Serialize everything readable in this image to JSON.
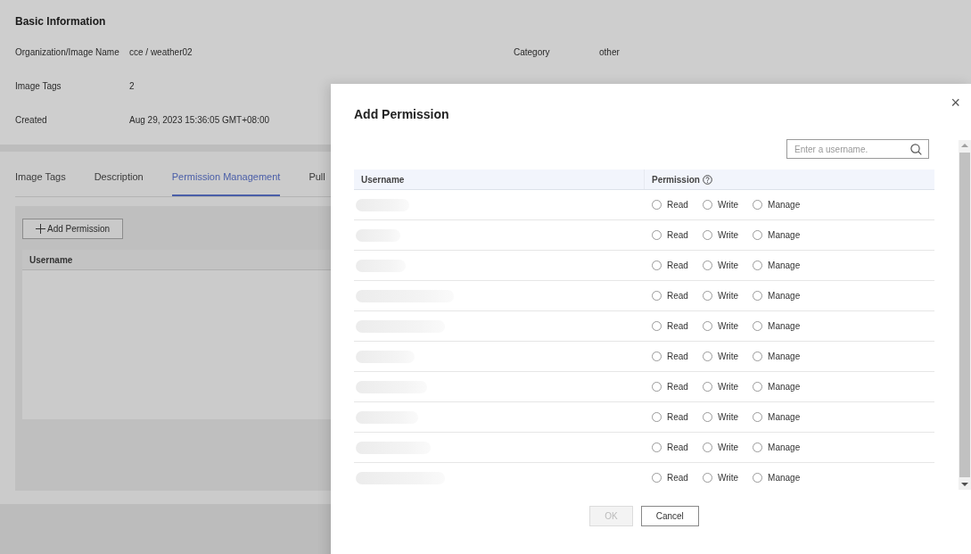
{
  "basic_info": {
    "title": "Basic Information",
    "fields": [
      {
        "label": "Organization/Image Name",
        "value": "cce / weather02"
      },
      {
        "label": "Image Tags",
        "value": "2"
      },
      {
        "label": "Created",
        "value": "Aug 29, 2023 15:36:05 GMT+08:00"
      }
    ],
    "side_fields": [
      {
        "label": "Category",
        "value": "other"
      }
    ]
  },
  "tabs": [
    {
      "label": "Image Tags",
      "selected": false
    },
    {
      "label": "Description",
      "selected": false
    },
    {
      "label": "Permission Management",
      "selected": true
    },
    {
      "label": "Pull",
      "selected": false
    }
  ],
  "panel": {
    "add_button": "Add Permission",
    "table": {
      "columns": [
        "Username"
      ]
    }
  },
  "dialog": {
    "title": "Add Permission",
    "close": "×",
    "search": {
      "placeholder": "Enter a username."
    },
    "columns": [
      "Username",
      "Permission"
    ],
    "rows": [
      {
        "options": [
          {
            "label": "Read",
            "selected": false
          },
          {
            "label": "Write",
            "selected": false
          },
          {
            "label": "Manage",
            "selected": false
          }
        ]
      },
      {
        "options": [
          {
            "label": "Read",
            "selected": false
          },
          {
            "label": "Write",
            "selected": false
          },
          {
            "label": "Manage",
            "selected": false
          }
        ]
      },
      {
        "options": [
          {
            "label": "Read",
            "selected": false
          },
          {
            "label": "Write",
            "selected": false
          },
          {
            "label": "Manage",
            "selected": false
          }
        ]
      },
      {
        "options": [
          {
            "label": "Read",
            "selected": false
          },
          {
            "label": "Write",
            "selected": false
          },
          {
            "label": "Manage",
            "selected": false
          }
        ]
      },
      {
        "options": [
          {
            "label": "Read",
            "selected": false
          },
          {
            "label": "Write",
            "selected": false
          },
          {
            "label": "Manage",
            "selected": false
          }
        ]
      },
      {
        "options": [
          {
            "label": "Read",
            "selected": false
          },
          {
            "label": "Write",
            "selected": false
          },
          {
            "label": "Manage",
            "selected": false
          }
        ]
      },
      {
        "options": [
          {
            "label": "Read",
            "selected": false
          },
          {
            "label": "Write",
            "selected": false
          },
          {
            "label": "Manage",
            "selected": false
          }
        ]
      },
      {
        "options": [
          {
            "label": "Read",
            "selected": false
          },
          {
            "label": "Write",
            "selected": false
          },
          {
            "label": "Manage",
            "selected": false
          }
        ]
      },
      {
        "options": [
          {
            "label": "Read",
            "selected": false
          },
          {
            "label": "Write",
            "selected": false
          },
          {
            "label": "Manage",
            "selected": false
          }
        ]
      },
      {
        "options": [
          {
            "label": "Read",
            "selected": false
          },
          {
            "label": "Write",
            "selected": false
          },
          {
            "label": "Manage",
            "selected": false
          }
        ]
      }
    ],
    "buttons": [
      {
        "label": "OK",
        "disabled": true
      },
      {
        "label": "Cancel",
        "disabled": false
      }
    ]
  }
}
